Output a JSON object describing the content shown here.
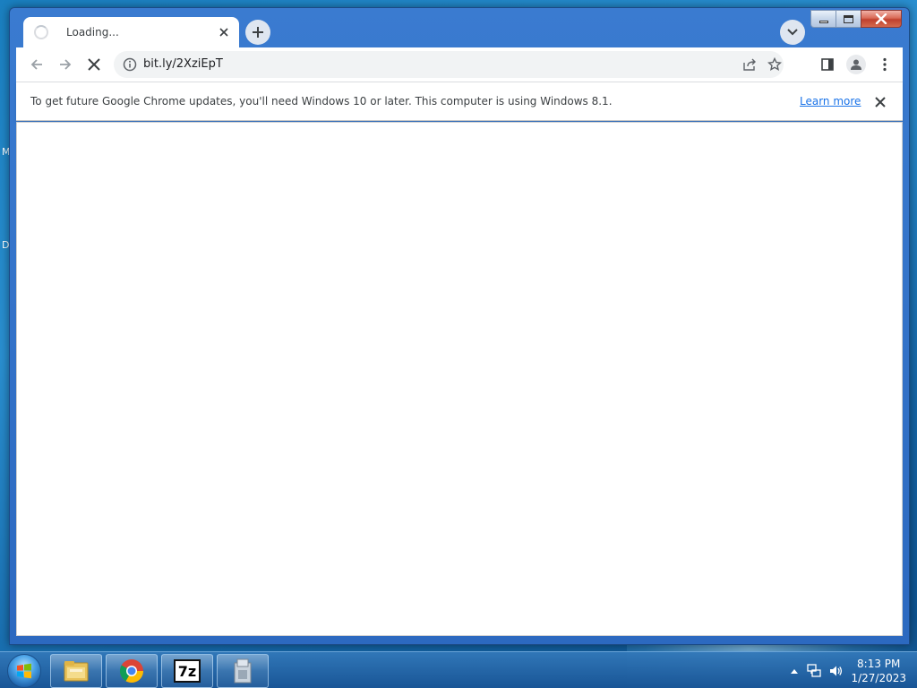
{
  "desktop": {
    "labels": [
      "M",
      "D"
    ]
  },
  "window": {
    "tab": {
      "title": "Loading..."
    },
    "toolbar": {
      "url": "bit.ly/2XziEpT"
    },
    "infobar": {
      "message": "To get future Google Chrome updates, you'll need Windows 10 or later. This computer is using Windows 8.1.",
      "link_label": "Learn more"
    }
  },
  "taskbar": {
    "apps": [
      "file-explorer",
      "chrome",
      "7-zip",
      "installer"
    ],
    "seven_zip_label": "7z",
    "clock": {
      "time": "8:13 PM",
      "date": "1/27/2023"
    }
  },
  "colors": {
    "accent": "#1a73e8",
    "tab_strip": "#2c69c0",
    "omnibox_bg": "#f1f3f4"
  }
}
